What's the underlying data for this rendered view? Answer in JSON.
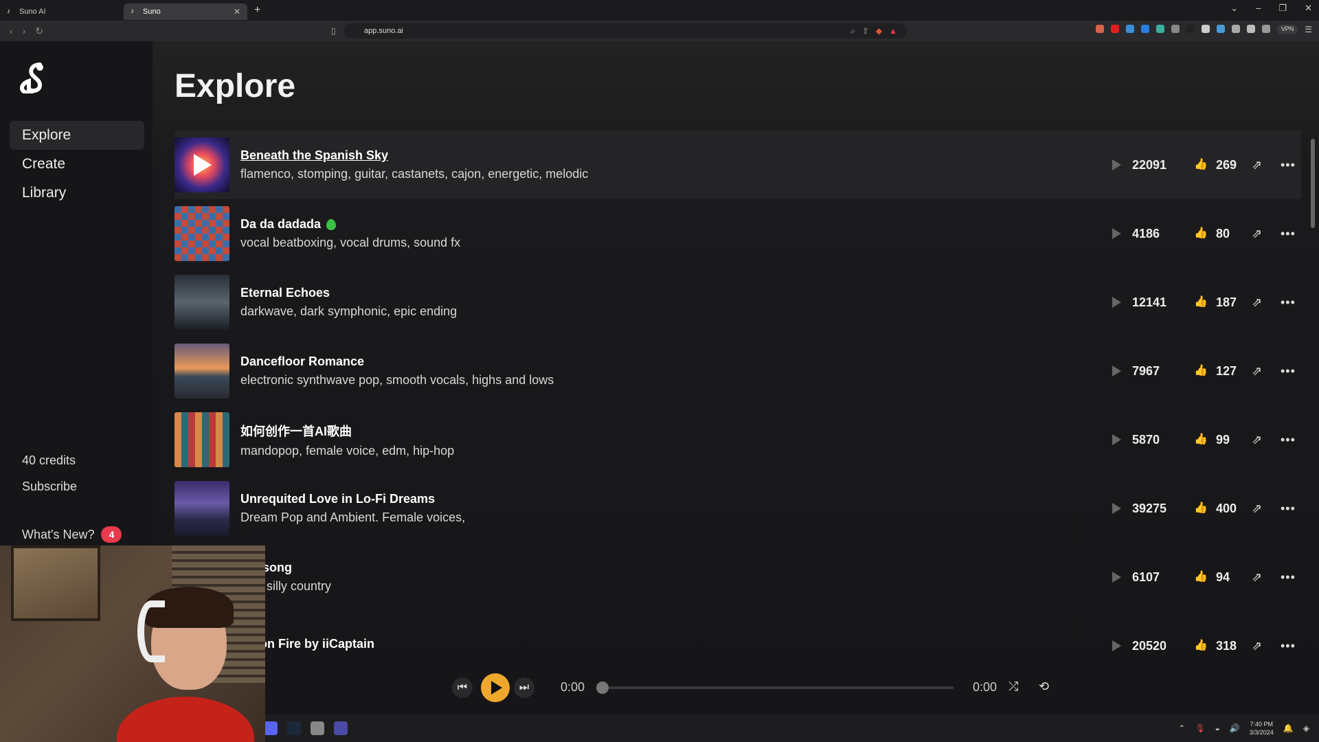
{
  "browser": {
    "tabs": [
      {
        "title": "Suno AI",
        "active": false
      },
      {
        "title": "Suno",
        "active": true
      }
    ],
    "url": "app.suno.ai",
    "vpn_label": "VPN"
  },
  "sidebar": {
    "nav": [
      {
        "label": "Explore",
        "active": true
      },
      {
        "label": "Create",
        "active": false
      },
      {
        "label": "Library",
        "active": false
      }
    ],
    "credits": "40 credits",
    "subscribe": "Subscribe",
    "whats_new": "What's New?",
    "whats_new_count": "4"
  },
  "main": {
    "title": "Explore",
    "songs": [
      {
        "title": "Beneath the Spanish Sky",
        "tags": "flamenco, stomping, guitar, castanets, cajon, energetic, melodic",
        "plays": "22091",
        "likes": "269"
      },
      {
        "title": "Da da dadada",
        "tags": "vocal beatboxing, vocal drums, sound fx",
        "plays": "4186",
        "likes": "80"
      },
      {
        "title": "Eternal Echoes",
        "tags": "darkwave, dark symphonic, epic ending",
        "plays": "12141",
        "likes": "187"
      },
      {
        "title": "Dancefloor Romance",
        "tags": "electronic synthwave pop, smooth vocals, highs and lows",
        "plays": "7967",
        "likes": "127"
      },
      {
        "title": "如何创作一首AI歌曲",
        "tags": "mandopop, female voice, edm, hip-hop",
        "plays": "5870",
        "likes": "99"
      },
      {
        "title": "Unrequited Love in Lo-Fi Dreams",
        "tags": "Dream Pop and Ambient. Female voices,",
        "plays": "39275",
        "likes": "400"
      },
      {
        "title": "ker song",
        "tags": "ious silly country",
        "plays": "6107",
        "likes": "94"
      },
      {
        "title": "rts on Fire by iiCaptain",
        "tags": "",
        "plays": "20520",
        "likes": "318"
      }
    ]
  },
  "player": {
    "time_current": "0:00",
    "time_total": "0:00"
  },
  "taskbar": {
    "time": "7:40 PM",
    "date": "3/3/2024"
  }
}
